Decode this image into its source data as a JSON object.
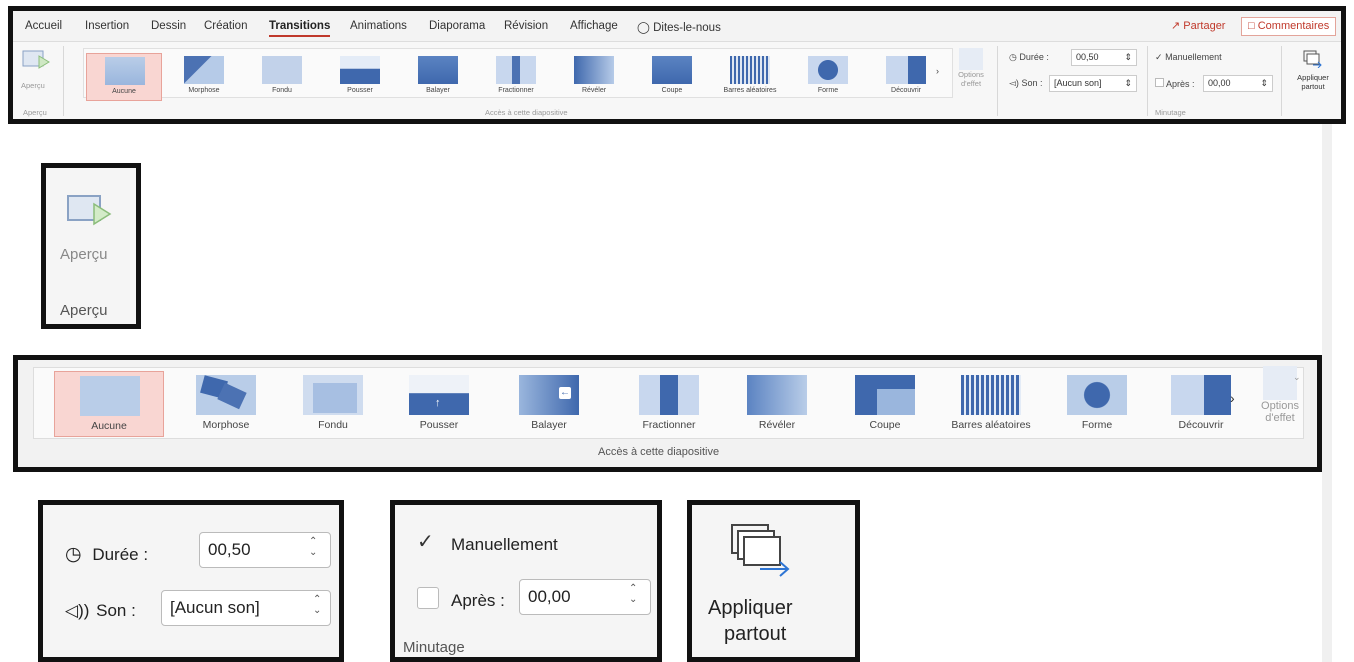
{
  "tabs": [
    "Accueil",
    "Insertion",
    "Dessin",
    "Création",
    "Transitions",
    "Animations",
    "Diaporama",
    "Révision",
    "Affichage",
    "Dites-le-nous"
  ],
  "share_label": "Partager",
  "comments_label": "Commentaires",
  "preview": {
    "label": "Aperçu",
    "group": "Aperçu"
  },
  "transitions": [
    "Aucune",
    "Morphose",
    "Fondu",
    "Pousser",
    "Balayer",
    "Fractionner",
    "Révéler",
    "Coupe",
    "Barres aléatoires",
    "Forme",
    "Découvrir"
  ],
  "selected_transition": "Aucune",
  "gallery_group": "Accès à cette diapositive",
  "effect_options": {
    "line1": "Options",
    "line2": "d'effet"
  },
  "timing": {
    "duration_label": "Durée :",
    "duration_value": "00,50",
    "sound_label": "Son :",
    "sound_value": "[Aucun son]",
    "manual_label": "Manuellement",
    "manual_checked": true,
    "after_label": "Après :",
    "after_value": "00,00",
    "after_checked": false,
    "group": "Minutage"
  },
  "apply_all": {
    "line1": "Appliquer",
    "line2": "partout"
  },
  "icons": {
    "preview": "preview-icon",
    "clock": "clock-icon",
    "sound": "speaker-icon",
    "check": "checkmark-icon",
    "apply": "apply-all-icon",
    "more": "chevron-right-icon"
  },
  "colors": {
    "accent": "#c0392b",
    "selected_bg": "#f9d6d2",
    "thumb_blue": "#9ab6dd",
    "thumb_dark": "#3f68ad"
  }
}
